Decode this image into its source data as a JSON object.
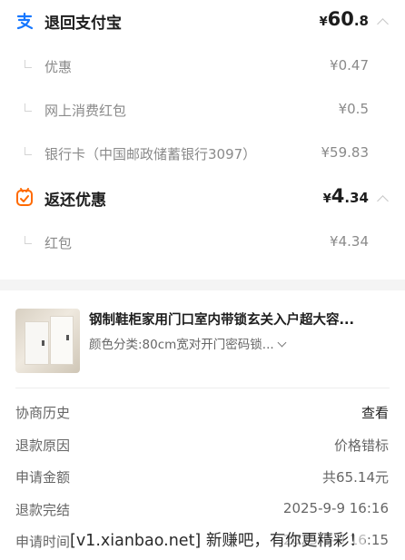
{
  "alipay_refund": {
    "icon": "alipay-icon",
    "title": "退回支付宝",
    "amount": {
      "currency": "¥",
      "integer": "60",
      "decimal": ".8"
    },
    "items": [
      {
        "label": "优惠",
        "amount": "¥0.47"
      },
      {
        "label": "网上消费红包",
        "amount": "¥0.5"
      },
      {
        "label": "银行卡（中国邮政储蓄银行3097）",
        "amount": "¥59.83"
      }
    ]
  },
  "cashback": {
    "icon": "coupon-icon",
    "title": "返还优惠",
    "amount": {
      "currency": "¥",
      "integer": "4",
      "decimal": ".34"
    },
    "items": [
      {
        "label": "红包",
        "amount": "¥4.34"
      }
    ]
  },
  "product": {
    "title": "钢制鞋柜家用门口室内带锁玄关入户超大容...",
    "spec": "颜色分类:80cm宽对开门密码锁..."
  },
  "info": [
    {
      "label": "协商历史",
      "value": "查看"
    },
    {
      "label": "退款原因",
      "value": "价格错标"
    },
    {
      "label": "申请金额",
      "value": "共65.14元"
    },
    {
      "label": "退款完结",
      "value": "2025-9-9 16:16"
    },
    {
      "label": "申请时间",
      "value": "2025-9-9 16:15"
    }
  ],
  "watermark": "[v1.xianbao.net] 新赚吧，有你更精彩！",
  "colors": {
    "alipay_blue": "#1677ff",
    "coupon_orange": "#ff6a00",
    "muted_text": "#8a8a8a"
  }
}
